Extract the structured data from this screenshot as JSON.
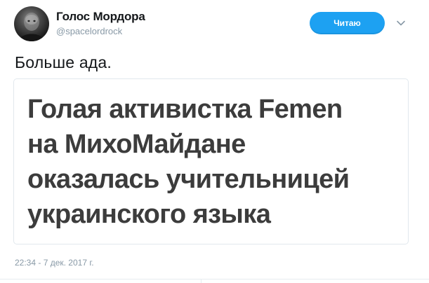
{
  "author": {
    "display_name": "Голос Мордора",
    "handle": "@spacelordrock"
  },
  "follow_button": {
    "label": "Читаю",
    "color": "#1da1f2"
  },
  "menu_icon": "chevron-down-icon",
  "tweet": {
    "text": "Больше ада."
  },
  "card": {
    "headline_lines": [
      "Голая активистка Femen",
      "на МихоМайдане",
      "оказалась учительницей",
      "украинского языка"
    ]
  },
  "timestamp": "22:34 - 7 дек. 2017 г."
}
